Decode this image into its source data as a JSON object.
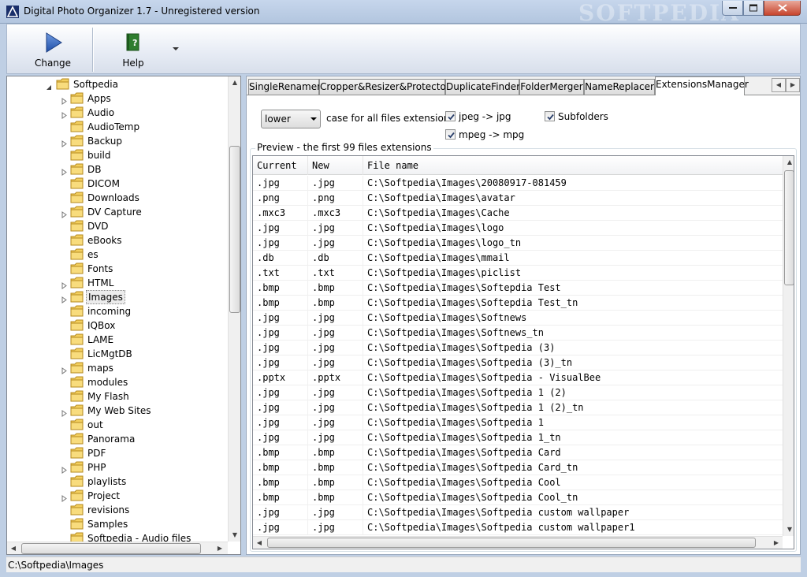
{
  "window": {
    "title": "Digital Photo Organizer 1.7 - Unregistered version",
    "watermark": "SOFTPEDIA"
  },
  "toolbar": {
    "change_label": "Change",
    "help_label": "Help"
  },
  "tree": {
    "root": "Softpedia",
    "items": [
      {
        "label": "Apps",
        "expandable": true
      },
      {
        "label": "Audio",
        "expandable": true
      },
      {
        "label": "AudioTemp",
        "expandable": false
      },
      {
        "label": "Backup",
        "expandable": true
      },
      {
        "label": "build",
        "expandable": false
      },
      {
        "label": "DB",
        "expandable": true
      },
      {
        "label": "DICOM",
        "expandable": false
      },
      {
        "label": "Downloads",
        "expandable": false
      },
      {
        "label": "DV Capture",
        "expandable": true
      },
      {
        "label": "DVD",
        "expandable": false
      },
      {
        "label": "eBooks",
        "expandable": false
      },
      {
        "label": "es",
        "expandable": false
      },
      {
        "label": "Fonts",
        "expandable": false
      },
      {
        "label": "HTML",
        "expandable": true
      },
      {
        "label": "Images",
        "expandable": true,
        "selected": true
      },
      {
        "label": "incoming",
        "expandable": false
      },
      {
        "label": "IQBox",
        "expandable": false
      },
      {
        "label": "LAME",
        "expandable": false
      },
      {
        "label": "LicMgtDB",
        "expandable": false
      },
      {
        "label": "maps",
        "expandable": true
      },
      {
        "label": "modules",
        "expandable": false
      },
      {
        "label": "My Flash",
        "expandable": false
      },
      {
        "label": "My Web Sites",
        "expandable": true
      },
      {
        "label": "out",
        "expandable": false
      },
      {
        "label": "Panorama",
        "expandable": false
      },
      {
        "label": "PDF",
        "expandable": false
      },
      {
        "label": "PHP",
        "expandable": true
      },
      {
        "label": "playlists",
        "expandable": false
      },
      {
        "label": "Project",
        "expandable": true
      },
      {
        "label": "revisions",
        "expandable": false
      },
      {
        "label": "Samples",
        "expandable": false
      },
      {
        "label": "Softpedia - Audio files",
        "expandable": false
      }
    ]
  },
  "tabs": [
    {
      "label": "SingleRenamer",
      "active": false
    },
    {
      "label": "Cropper&Resizer&Protector",
      "active": false
    },
    {
      "label": "DuplicateFinder",
      "active": false
    },
    {
      "label": "FolderMerger",
      "active": false
    },
    {
      "label": "NameReplacer",
      "active": false
    },
    {
      "label": "ExtensionsManager",
      "active": true
    }
  ],
  "extensions_manager": {
    "case_select_value": "lower",
    "case_label": "case for all files extensions",
    "jpeg_label": "jpeg -> jpg",
    "jpeg_checked": true,
    "mpeg_label": "mpeg -> mpg",
    "mpeg_checked": true,
    "subfolders_label": "Subfolders",
    "subfolders_checked": true,
    "preview_title": "Preview - the first 99 files extensions",
    "columns": [
      "Current",
      "New",
      "File name"
    ],
    "rows": [
      [
        ".jpg",
        ".jpg",
        "C:\\Softpedia\\Images\\20080917-081459"
      ],
      [
        ".png",
        ".png",
        "C:\\Softpedia\\Images\\avatar"
      ],
      [
        ".mxc3",
        ".mxc3",
        "C:\\Softpedia\\Images\\Cache"
      ],
      [
        ".jpg",
        ".jpg",
        "C:\\Softpedia\\Images\\logo"
      ],
      [
        ".jpg",
        ".jpg",
        "C:\\Softpedia\\Images\\logo_tn"
      ],
      [
        ".db",
        ".db",
        "C:\\Softpedia\\Images\\mmail"
      ],
      [
        ".txt",
        ".txt",
        "C:\\Softpedia\\Images\\piclist"
      ],
      [
        ".bmp",
        ".bmp",
        "C:\\Softpedia\\Images\\Softepdia Test"
      ],
      [
        ".bmp",
        ".bmp",
        "C:\\Softpedia\\Images\\Softepdia Test_tn"
      ],
      [
        ".jpg",
        ".jpg",
        "C:\\Softpedia\\Images\\Softnews"
      ],
      [
        ".jpg",
        ".jpg",
        "C:\\Softpedia\\Images\\Softnews_tn"
      ],
      [
        ".jpg",
        ".jpg",
        "C:\\Softpedia\\Images\\Softpedia (3)"
      ],
      [
        ".jpg",
        ".jpg",
        "C:\\Softpedia\\Images\\Softpedia (3)_tn"
      ],
      [
        ".pptx",
        ".pptx",
        "C:\\Softpedia\\Images\\Softpedia - VisualBee"
      ],
      [
        ".jpg",
        ".jpg",
        "C:\\Softpedia\\Images\\Softpedia 1 (2)"
      ],
      [
        ".jpg",
        ".jpg",
        "C:\\Softpedia\\Images\\Softpedia 1 (2)_tn"
      ],
      [
        ".jpg",
        ".jpg",
        "C:\\Softpedia\\Images\\Softpedia 1"
      ],
      [
        ".jpg",
        ".jpg",
        "C:\\Softpedia\\Images\\Softpedia 1_tn"
      ],
      [
        ".bmp",
        ".bmp",
        "C:\\Softpedia\\Images\\Softpedia Card"
      ],
      [
        ".bmp",
        ".bmp",
        "C:\\Softpedia\\Images\\Softpedia Card_tn"
      ],
      [
        ".bmp",
        ".bmp",
        "C:\\Softpedia\\Images\\Softpedia Cool"
      ],
      [
        ".bmp",
        ".bmp",
        "C:\\Softpedia\\Images\\Softpedia Cool_tn"
      ],
      [
        ".jpg",
        ".jpg",
        "C:\\Softpedia\\Images\\Softpedia custom wallpaper"
      ],
      [
        ".jpg",
        ".jpg",
        "C:\\Softpedia\\Images\\Softpedia custom wallpaper1"
      ]
    ]
  },
  "status": {
    "path": "C:\\Softpedia\\Images"
  }
}
